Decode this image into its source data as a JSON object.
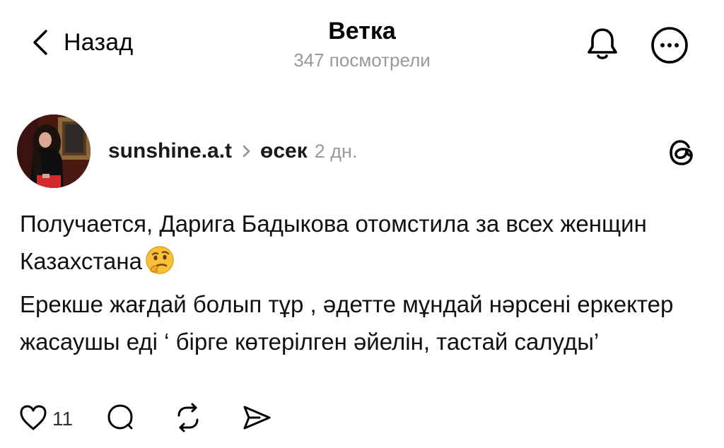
{
  "header": {
    "back_label": "Назад",
    "title": "Ветка",
    "views": "347 посмотрели",
    "icons": [
      "chevron-left-icon",
      "bell-icon",
      "more-horizontal-icon"
    ]
  },
  "post": {
    "username": "sunshine.a.t",
    "topic": "өсек",
    "age": "2 дн.",
    "body": {
      "line1": "Получается, Дарига Бадыкова отомстила за всех женщин Казахстана",
      "line2": "Ерекше жағдай болып тұр , әдетте мұндай нәрсені еркектер жасаушы еді ‘ бірге көтерілген әйелін, тастай салуды’"
    },
    "emoji": "thinking-face",
    "actions": {
      "like_count": "11",
      "icons": [
        "heart-icon",
        "comment-icon",
        "repost-icon",
        "share-icon"
      ]
    }
  },
  "colors": {
    "text": "#000000",
    "secondary": "#999999",
    "background": "#ffffff"
  }
}
